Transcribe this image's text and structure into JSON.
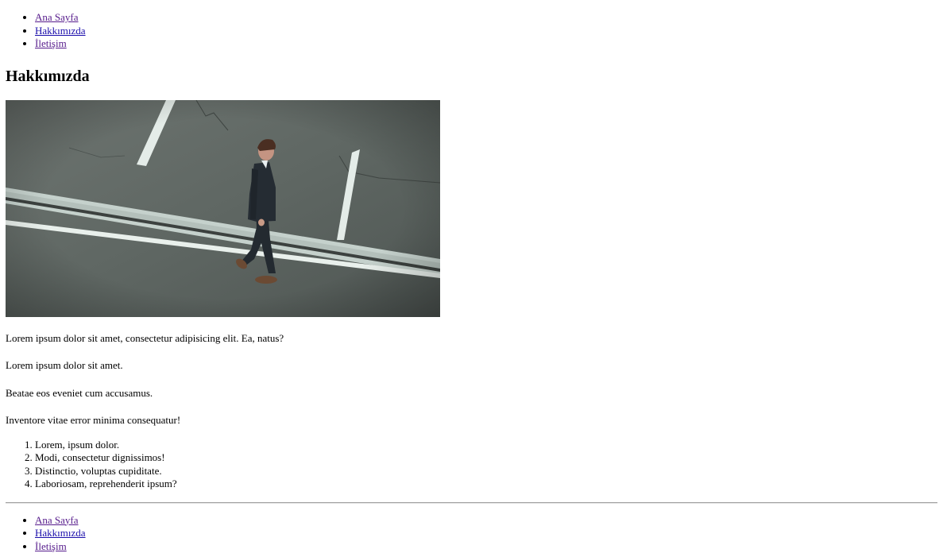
{
  "nav_top": [
    {
      "label": "Ana Sayfa"
    },
    {
      "label": "Hakkımızda"
    },
    {
      "label": "İletişim"
    }
  ],
  "heading": "Hakkımızda",
  "hero_image": {
    "subject": "man in dark suit walking across road"
  },
  "paragraphs": [
    "Lorem ipsum dolor sit amet, consectetur adipisicing elit. Ea, natus?",
    "Lorem ipsum dolor sit amet.",
    "Beatae eos eveniet cum accusamus.",
    "Inventore vitae error minima consequatur!"
  ],
  "ordered_list": [
    "Lorem, ipsum dolor.",
    "Modi, consectetur dignissimos!",
    "Distinctio, voluptas cupiditate.",
    "Laboriosam, reprehenderit ipsum?"
  ],
  "nav_bottom": [
    {
      "label": "Ana Sayfa"
    },
    {
      "label": "Hakkımızda"
    },
    {
      "label": "İletişim"
    }
  ],
  "colors": {
    "link": "#1a0dab",
    "visited_link": "#551a8b",
    "asphalt": "#5d6460",
    "road_marking": "#e4ece8"
  }
}
